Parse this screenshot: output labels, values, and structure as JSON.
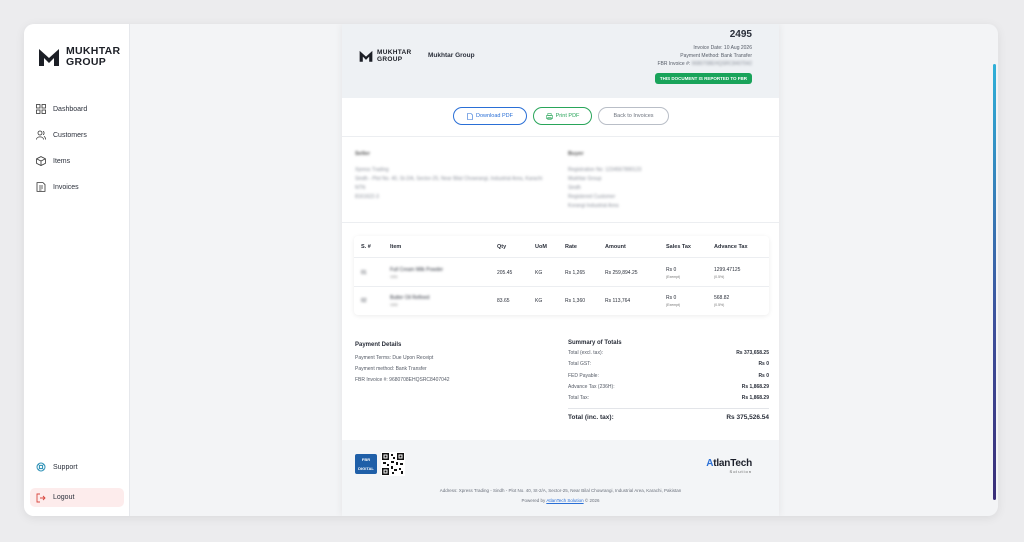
{
  "brand": {
    "line1": "MUKHTAR",
    "line2": "GROUP"
  },
  "sidebar": {
    "items": [
      {
        "label": "Dashboard",
        "icon": "dashboard-icon"
      },
      {
        "label": "Customers",
        "icon": "users-icon"
      },
      {
        "label": "Items",
        "icon": "box-icon"
      },
      {
        "label": "Invoices",
        "icon": "invoice-icon"
      }
    ],
    "support": "Support",
    "logout": "Logout"
  },
  "invoice": {
    "company": "Mukhtar Group",
    "number": "2495",
    "date_line": "Invoice Date: 10 Aug 2026",
    "payment_line": "Payment Method: Bank Transfer",
    "fbr_label": "FBR Invoice #:",
    "fbr_value": "9680708EHQSRC8407042",
    "badge": "THIS DOCUMENT IS REPORTED TO FBR"
  },
  "actions": {
    "download": "Download PDF",
    "print": "Print PDF",
    "back": "Back to Invoices"
  },
  "seller": {
    "title": "Seller",
    "name": "Xpress Trading",
    "address": "Sindh - Plot No. 40, St-2/A, Sector-25, Near Bilal Chowrangi, Industrial Area, Karachi",
    "line3": "NTN",
    "line4": "8161622-3"
  },
  "buyer": {
    "title": "Buyer",
    "line1": "Registration No: 1234567890123",
    "line2": "Mukhtar Group",
    "line3": "Sindh",
    "line4": "Registered Customer",
    "line5": "Korangi Industrial Area"
  },
  "table": {
    "headers": [
      "S. #",
      "Item",
      "Qty",
      "UoM",
      "Rate",
      "Amount",
      "Sales Tax",
      "Advance Tax"
    ],
    "rows": [
      {
        "sn": "01",
        "item": "Full Cream Milk Powder",
        "code": "1001",
        "qty": "205.45",
        "uom": "KG",
        "rate": "Rs 1,265",
        "amount": "Rs 259,894.25",
        "tax": "Rs 0",
        "tax_note": "(Exempt)",
        "adv": "1299.47125",
        "adv_note": "(0.5%)"
      },
      {
        "sn": "02",
        "item": "Butter Oil Refined",
        "code": "1002",
        "qty": "83.65",
        "uom": "KG",
        "rate": "Rs 1,360",
        "amount": "Rs 113,764",
        "tax": "Rs 0",
        "tax_note": "(Exempt)",
        "adv": "568.82",
        "adv_note": "(0.5%)"
      }
    ]
  },
  "payment": {
    "title": "Payment Details",
    "terms": "Payment Terms: Due Upon Receipt",
    "method": "Payment method: Bank Transfer",
    "fbr": "FBR Invoice #: 9680708EHQSRC8407042"
  },
  "summary": {
    "title": "Summary of Totals",
    "rows": [
      {
        "label": "Total (excl. tax):",
        "value": "Rs 373,658.25"
      },
      {
        "label": "Total GST:",
        "value": "Rs 0"
      },
      {
        "label": "FED Payable:",
        "value": "Rs 0"
      },
      {
        "label": "Advance Tax (236H):",
        "value": "Rs 1,868.29"
      },
      {
        "label": "Total Tax:",
        "value": "Rs 1,868.29"
      }
    ],
    "total_label": "Total (inc. tax):",
    "total_value": "Rs 375,526.54"
  },
  "footer": {
    "fbr_logo_top": "FBR",
    "fbr_logo_bottom": "DIGITAL",
    "atlan_prefix": "A",
    "atlan_rest": "tlanTech",
    "atlan_sub": "Solution",
    "address": "Address: Xpress Trading - Sindh - Plot No. 40, St-2/A, Sector-25, Near Bilal Chowrangi, Industrial Area, Karachi, Pakistan",
    "powered_prefix": "Powered by",
    "powered_link": "AtlanTech Solution",
    "powered_suffix": "© 2026"
  },
  "colors": {
    "accent": "#2a6fd6",
    "success": "#19a35a",
    "logout_bg": "#fdecec"
  }
}
